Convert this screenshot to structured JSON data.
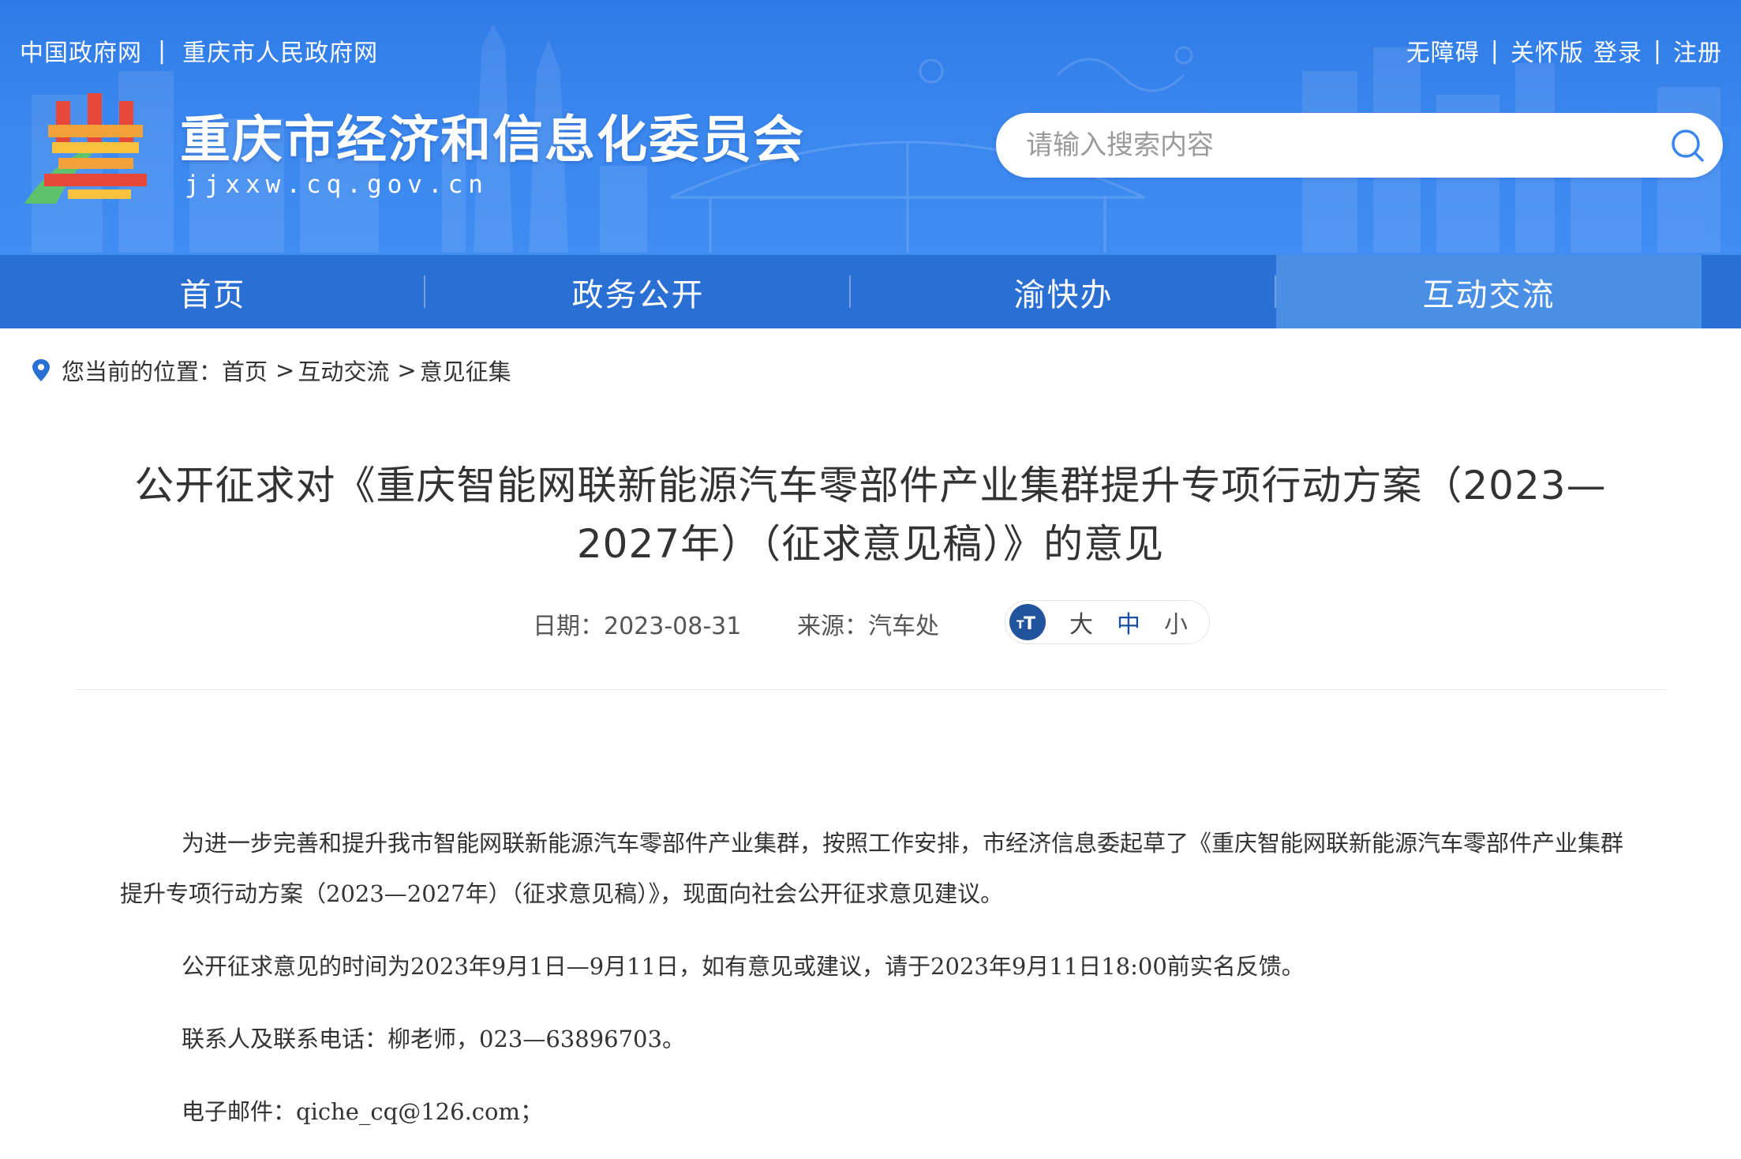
{
  "header": {
    "top_links": [
      "中国政府网",
      "重庆市人民政府网"
    ],
    "top_right": {
      "accessibility": "无障碍",
      "care_mode": "关怀版",
      "login": "登录",
      "register": "注册"
    },
    "site_title": "重庆市经济和信息化委员会",
    "site_domain": "jjxxw.cq.gov.cn",
    "search": {
      "placeholder": "请输入搜索内容",
      "value": ""
    },
    "brand_colors": {
      "banner": "#3a86ee",
      "nav": "#2a6fd4",
      "nav_active": "#4a8fe6"
    }
  },
  "nav": {
    "items": [
      {
        "label": "首页"
      },
      {
        "label": "政务公开"
      },
      {
        "label": "渝快办"
      },
      {
        "label": "互动交流"
      }
    ],
    "active": "互动交流"
  },
  "breadcrumb": {
    "prefix": "您当前的位置：",
    "items": [
      "首页",
      "互动交流",
      "意见征集"
    ],
    "arrow": ">"
  },
  "article": {
    "title": "公开征求对《重庆智能网联新能源汽车零部件产业集群提升专项行动方案（2023—2027年）（征求意见稿）》的意见",
    "date_label": "日期：",
    "date": "2023-08-31",
    "source_label": "来源：",
    "source": "汽车处",
    "font_size": {
      "large": "大",
      "medium": "中",
      "small": "小",
      "selected": "中"
    },
    "paragraphs": [
      "为进一步完善和提升我市智能网联新能源汽车零部件产业集群，按照工作安排，市经济信息委起草了《重庆智能网联新能源汽车零部件产业集群提升专项行动方案（2023—2027年）（征求意见稿）》，现面向社会公开征求意见建议。",
      "公开征求意见的时间为2023年9月1日—9月11日，如有意见或建议，请于2023年9月11日18:00前实名反馈。",
      "联系人及联系电话：柳老师，023—63896703。",
      "电子邮件：qiche_cq@126.com；"
    ]
  }
}
